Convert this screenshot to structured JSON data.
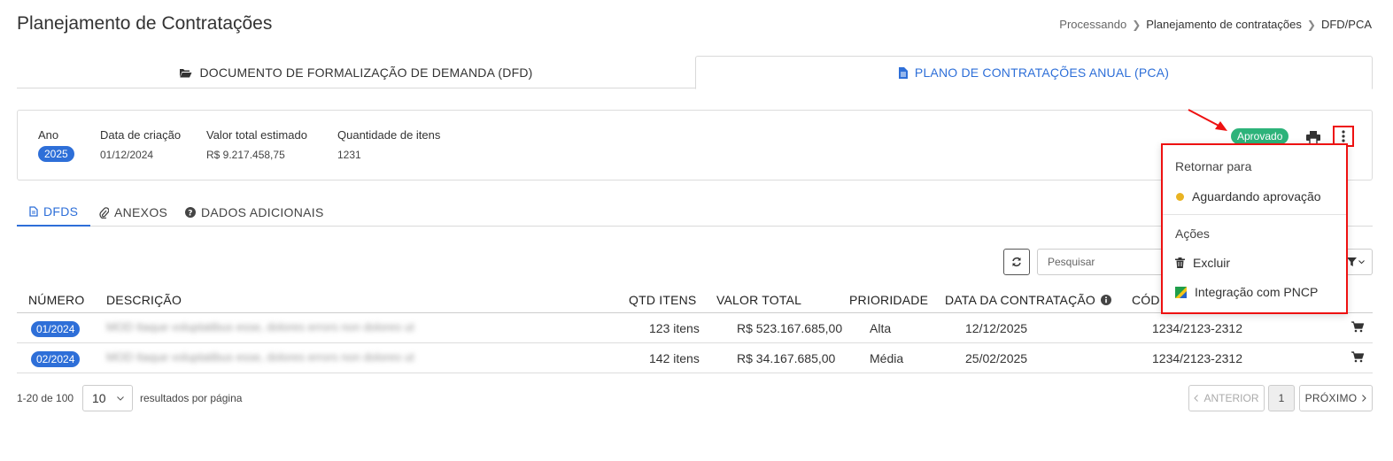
{
  "page": {
    "title": "Planejamento de Contratações"
  },
  "breadcrumb": [
    "Processando",
    "Planejamento de contratações",
    "DFD/PCA"
  ],
  "main_tabs": [
    {
      "label": "DOCUMENTO DE FORMALIZAÇÃO DE DEMANDA (DFD)",
      "icon": "folder-open-icon"
    },
    {
      "label": "PLANO DE CONTRATAÇÕES ANUAL (PCA)",
      "icon": "file-icon",
      "active": true
    }
  ],
  "info": {
    "year_label": "Ano",
    "year_value": "2025",
    "created_label": "Data de criação",
    "created_value": "01/12/2024",
    "total_label": "Valor total estimado",
    "total_value": "R$ 9.217.458,75",
    "qty_label": "Quantidade de itens",
    "qty_value": "1231",
    "status": "Aprovado"
  },
  "sub_tabs": [
    {
      "label": "DFDS",
      "icon": "document-icon",
      "active": true
    },
    {
      "label": "ANEXOS",
      "icon": "paperclip-icon"
    },
    {
      "label": "DADOS ADICIONAIS",
      "icon": "question-circle-icon"
    }
  ],
  "search": {
    "placeholder": "Pesquisar"
  },
  "table": {
    "columns": [
      "NÚMERO",
      "DESCRIÇÃO",
      "QTD ITENS",
      "VALOR TOTAL",
      "PRIORIDADE",
      "DATA DA CONTRATAÇÃO",
      "CÓDI"
    ],
    "rows": [
      {
        "numero": "01/2024",
        "descricao": "",
        "qtd": "123 itens",
        "valor": "R$ 523.167.685,00",
        "prioridade": "Alta",
        "data": "12/12/2025",
        "codigo": "1234/2123-2312"
      },
      {
        "numero": "02/2024",
        "descricao": "",
        "qtd": "142 itens",
        "valor": "R$ 34.167.685,00",
        "prioridade": "Média",
        "data": "25/02/2025",
        "codigo": "1234/2123-2312"
      }
    ]
  },
  "pagination": {
    "info": "1-20 de 100",
    "per_page": "10",
    "per_page_label": "resultados por página",
    "prev": "ANTERIOR",
    "current": "1",
    "next": "PRÓXIMO"
  },
  "dropdown": {
    "return_header": "Retornar para",
    "return_item": "Aguardando aprovação",
    "actions_header": "Ações",
    "delete": "Excluir",
    "pncp": "Integração com PNCP"
  },
  "colors": {
    "primary": "#2e6fd8",
    "success": "#2db37a",
    "warning": "#e9b322",
    "highlight": "#ee1111"
  }
}
